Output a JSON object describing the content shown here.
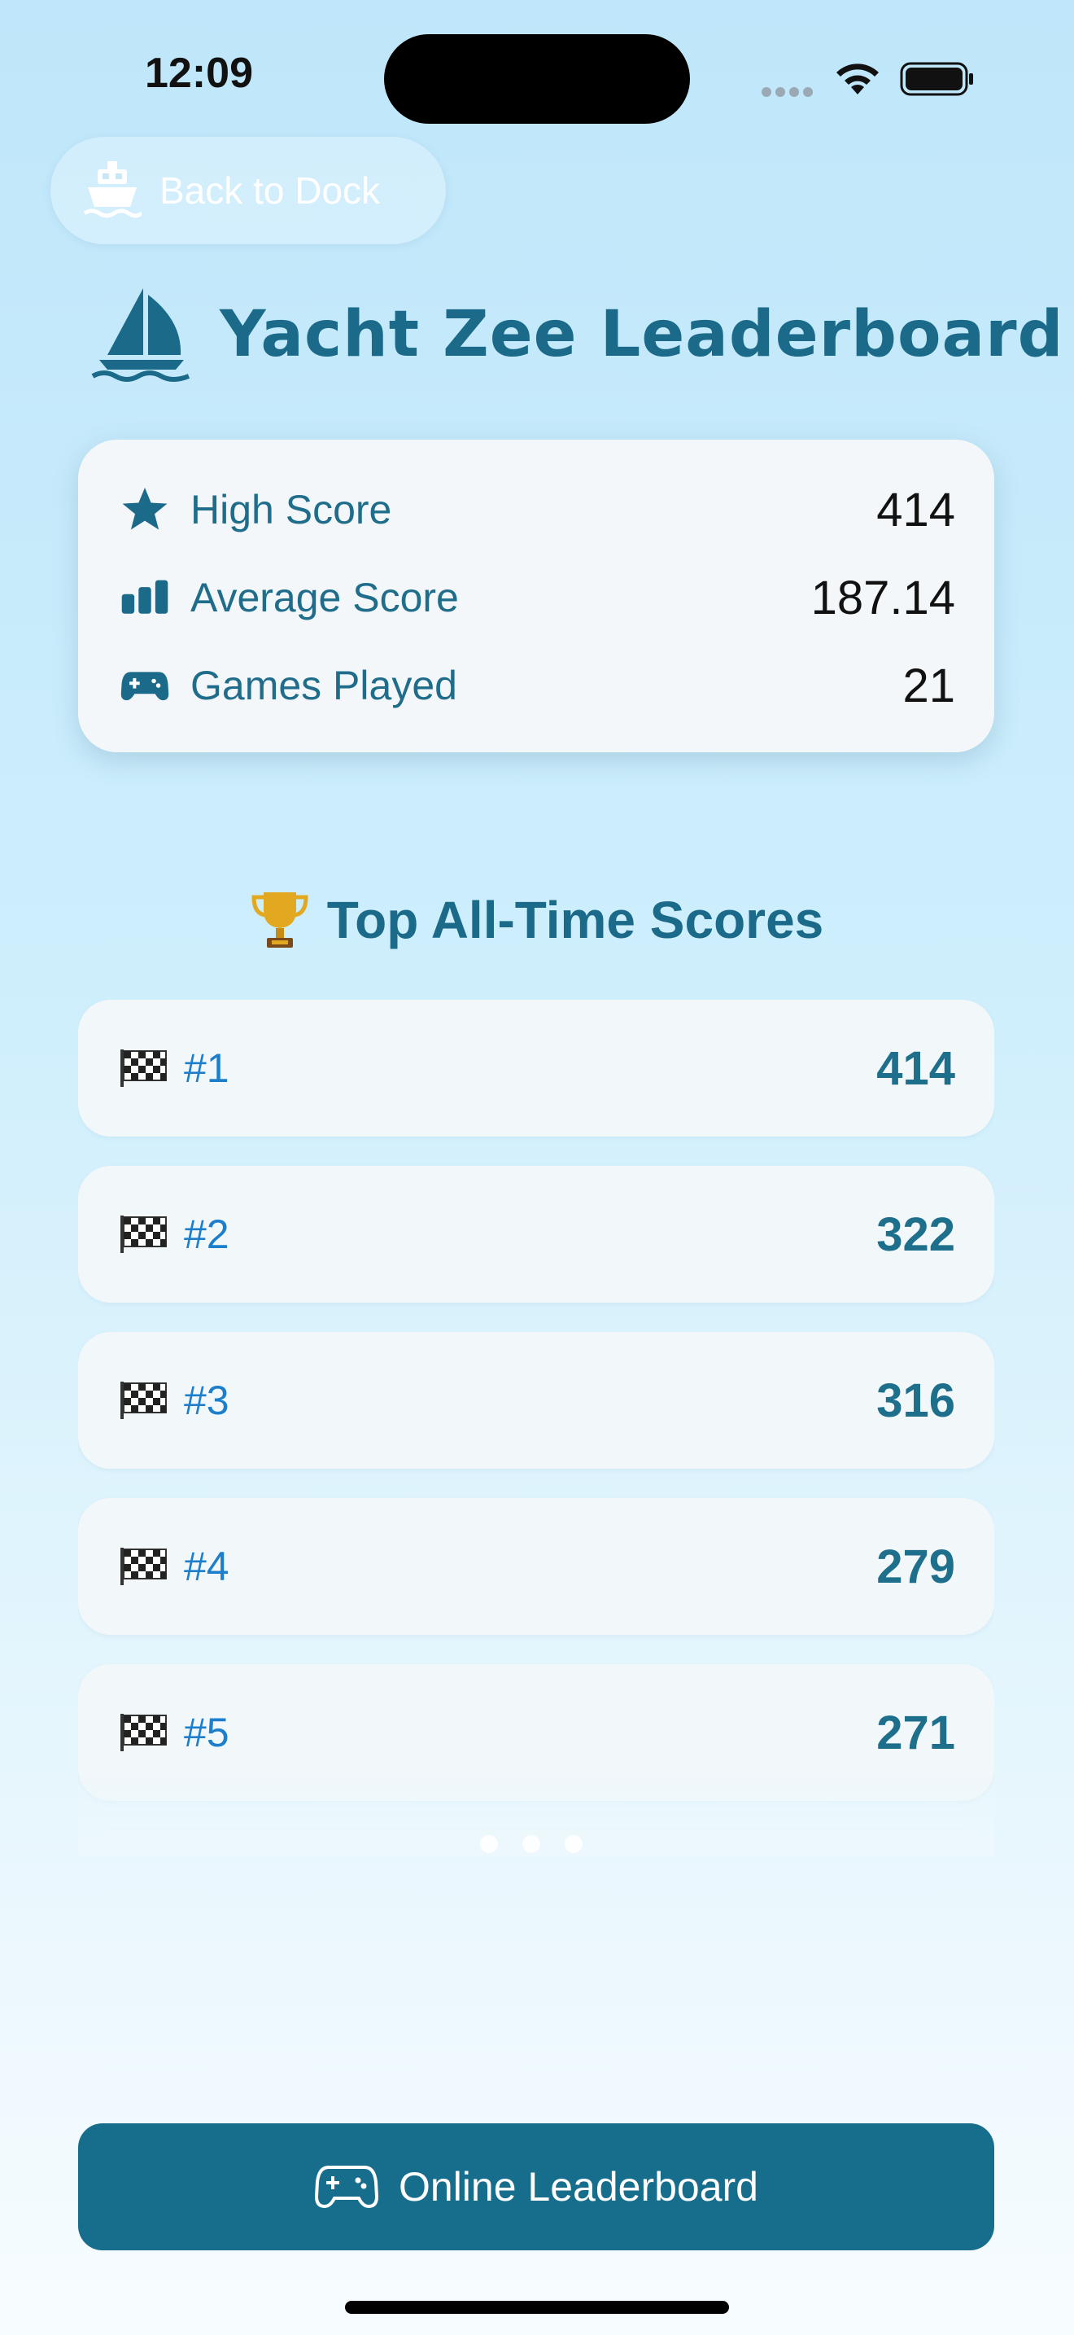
{
  "status_bar": {
    "time": "12:09"
  },
  "back_button": {
    "label": "Back to Dock",
    "icon": "ship-icon"
  },
  "title": {
    "text": "Yacht Zee Leaderboard",
    "icon": "sailboat-icon"
  },
  "stats": [
    {
      "icon": "star-icon",
      "label": "High Score",
      "value": "414"
    },
    {
      "icon": "bar-chart-icon",
      "label": "Average Score",
      "value": "187.14"
    },
    {
      "icon": "gamepad-icon",
      "label": "Games Played",
      "value": "21"
    }
  ],
  "top_scores": {
    "heading": "Top All-Time Scores",
    "heading_icon": "trophy-icon",
    "entries": [
      {
        "rank": "#1",
        "score": "414"
      },
      {
        "rank": "#2",
        "score": "322"
      },
      {
        "rank": "#3",
        "score": "316"
      },
      {
        "rank": "#4",
        "score": "279"
      },
      {
        "rank": "#5",
        "score": "271"
      }
    ]
  },
  "online_button": {
    "label": "Online Leaderboard",
    "icon": "gamepad-icon"
  },
  "colors": {
    "accent": "#176e8c",
    "title": "#1b6a8a",
    "rank": "#1d7fcc"
  }
}
